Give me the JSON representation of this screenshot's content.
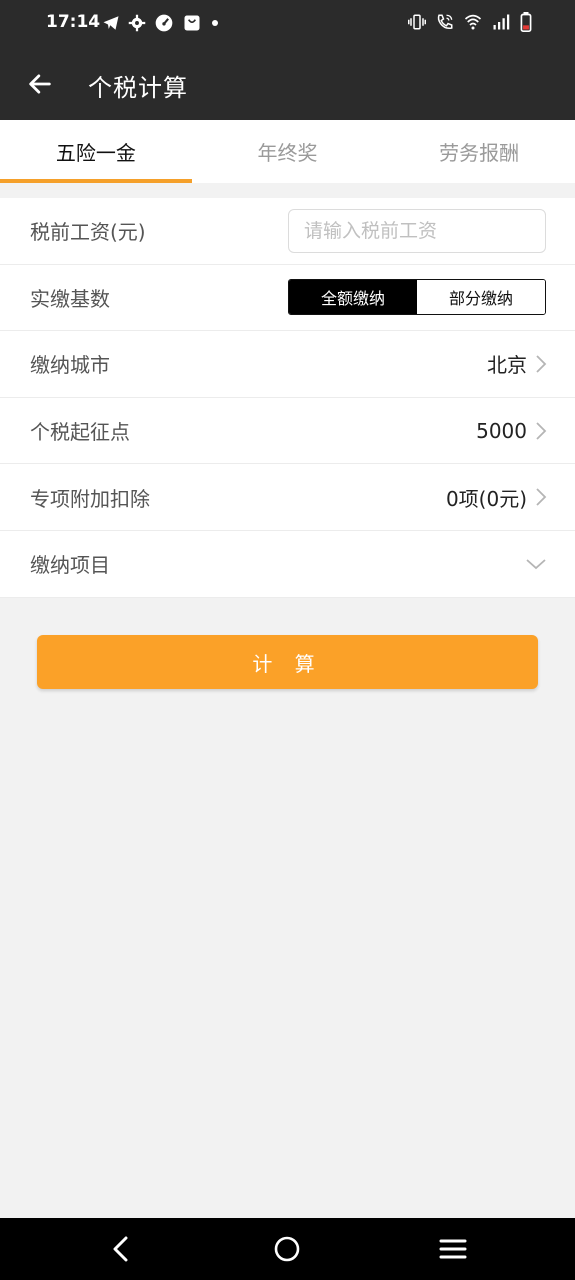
{
  "status_bar": {
    "time": "17:14",
    "left_icons": [
      "telegram-icon",
      "settings-icon",
      "speedometer-icon",
      "shopping-bag-icon",
      "dot-icon"
    ],
    "right_icons": [
      "vibrate-icon",
      "wifi-calling-icon",
      "wifi-icon",
      "signal-icon",
      "battery-icon"
    ]
  },
  "app_bar": {
    "title": "个税计算",
    "back_icon": "arrow-left-icon"
  },
  "tabs": [
    {
      "label": "五险一金",
      "active": true
    },
    {
      "label": "年终奖",
      "active": false
    },
    {
      "label": "劳务报酬",
      "active": false
    }
  ],
  "form": {
    "salary": {
      "label": "税前工资(元)",
      "placeholder": "请输入税前工资",
      "value": ""
    },
    "base": {
      "label": "实缴基数",
      "options": [
        "全额缴纳",
        "部分缴纳"
      ],
      "selected": "全额缴纳"
    },
    "city": {
      "label": "缴纳城市",
      "value": "北京"
    },
    "threshold": {
      "label": "个税起征点",
      "value": "5000"
    },
    "deduction": {
      "label": "专项附加扣除",
      "value": "0项(0元)"
    },
    "items": {
      "label": "缴纳项目"
    }
  },
  "calculate_button": "计 算",
  "colors": {
    "accent": "#fba128",
    "bar": "#2b2b2b",
    "background": "#f2f2f2"
  },
  "nav_bar": {
    "icons": [
      "back-nav-icon",
      "home-nav-icon",
      "recents-nav-icon"
    ]
  }
}
